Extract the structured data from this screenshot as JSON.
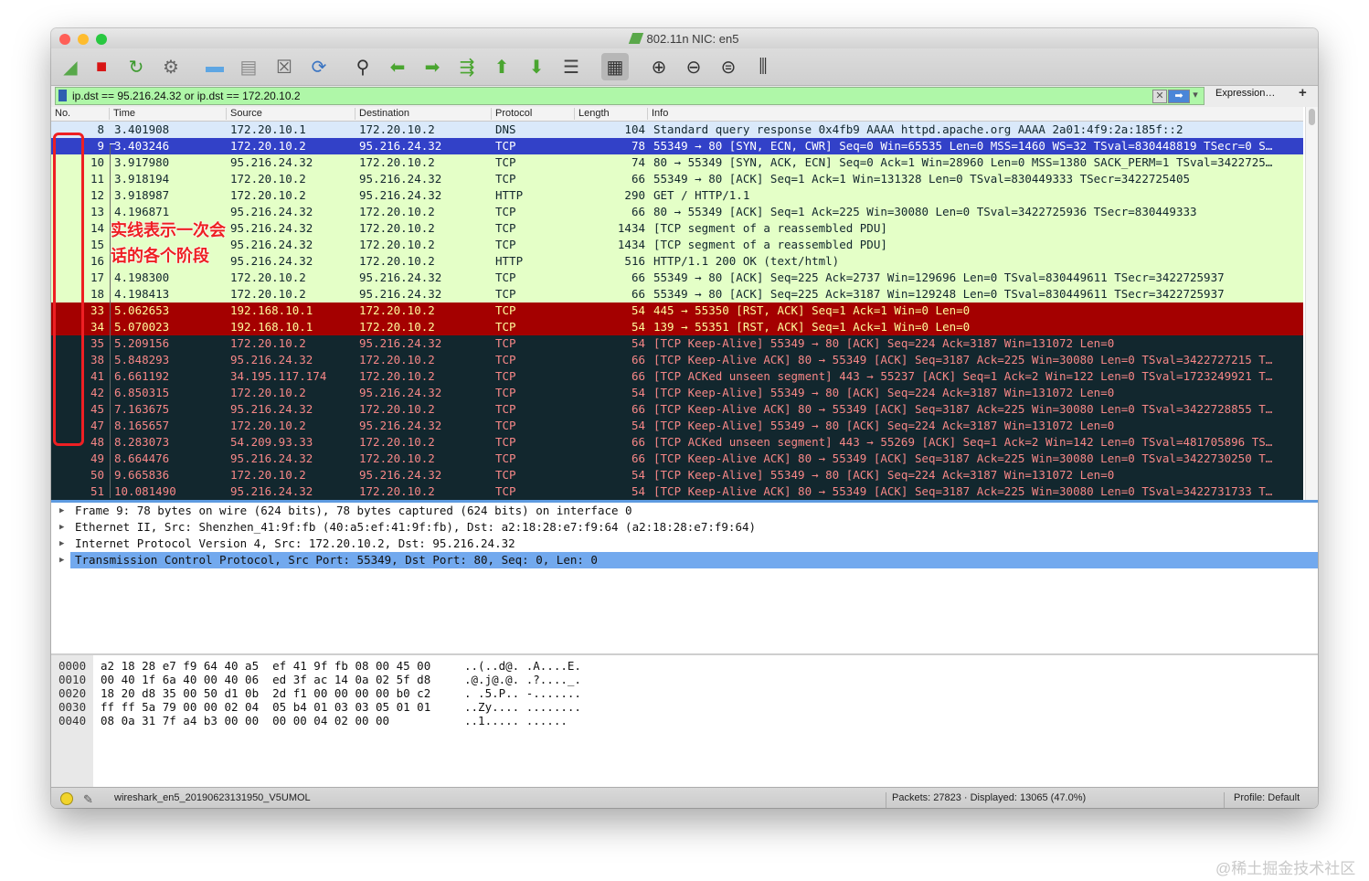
{
  "window": {
    "title": "802.11n NIC: en5",
    "traffic_lights": [
      "#ff5f57",
      "#febc2e",
      "#28c840"
    ]
  },
  "toolbar": {
    "buttons": [
      {
        "name": "start-capture-button",
        "icon": "shark-fin-icon",
        "glyph": "◢",
        "color": "#58a84a"
      },
      {
        "name": "stop-capture-button",
        "icon": "stop-icon",
        "glyph": "■",
        "color": "#d81414"
      },
      {
        "name": "restart-capture-button",
        "icon": "restart-icon",
        "glyph": "↻",
        "color": "#3d9a2f"
      },
      {
        "name": "capture-options-button",
        "icon": "gear-icon",
        "glyph": "⚙",
        "color": "#666666"
      },
      {
        "name": "open-file-button",
        "icon": "folder-icon",
        "glyph": "▬",
        "color": "#5ea6e3"
      },
      {
        "name": "save-file-button",
        "icon": "file-icon",
        "glyph": "▤",
        "color": "#8a8a8a"
      },
      {
        "name": "close-file-button",
        "icon": "close-file-icon",
        "glyph": "☒",
        "color": "#666666"
      },
      {
        "name": "reload-file-button",
        "icon": "reload-icon",
        "glyph": "⟳",
        "color": "#3a74c2"
      },
      {
        "name": "find-packet-button",
        "icon": "search-icon",
        "glyph": "⚲",
        "color": "#333333"
      },
      {
        "name": "go-back-button",
        "icon": "arrow-left-icon",
        "glyph": "⬅",
        "color": "#4aa530"
      },
      {
        "name": "go-forward-button",
        "icon": "arrow-right-icon",
        "glyph": "➡",
        "color": "#4aa530"
      },
      {
        "name": "go-to-packet-button",
        "icon": "go-to-packet-icon",
        "glyph": "⇶",
        "color": "#4aa530"
      },
      {
        "name": "first-packet-button",
        "icon": "arrow-up-icon",
        "glyph": "⬆",
        "color": "#4aa530"
      },
      {
        "name": "last-packet-button",
        "icon": "arrow-down-icon",
        "glyph": "⬇",
        "color": "#4aa530"
      },
      {
        "name": "auto-scroll-button",
        "icon": "auto-scroll-icon",
        "glyph": "☰",
        "color": "#444444"
      },
      {
        "name": "colorize-button",
        "icon": "colorize-icon",
        "glyph": "▦",
        "color": "#333333"
      },
      {
        "name": "zoom-in-button",
        "icon": "zoom-in-icon",
        "glyph": "⊕",
        "color": "#333333"
      },
      {
        "name": "zoom-out-button",
        "icon": "zoom-out-icon",
        "glyph": "⊖",
        "color": "#333333"
      },
      {
        "name": "normal-size-button",
        "icon": "zoom-reset-icon",
        "glyph": "⊜",
        "color": "#333333"
      },
      {
        "name": "resize-columns-button",
        "icon": "resize-columns-icon",
        "glyph": "⫼",
        "color": "#333333"
      }
    ]
  },
  "filter": {
    "value": "ip.dst == 95.216.24.32 or ip.dst == 172.20.10.2",
    "expression_label": "Expression…",
    "add_label": "+",
    "clear_glyph": "✕",
    "apply_glyph": "➡",
    "dropdown_glyph": "▾"
  },
  "columns": {
    "no": "No.",
    "time": "Time",
    "source": "Source",
    "destination": "Destination",
    "protocol": "Protocol",
    "length": "Length",
    "info": "Info"
  },
  "row_styles": {
    "dns": {
      "bg": "#dae9fa",
      "fg": "#12272e"
    },
    "selected": {
      "bg": "#3241c8",
      "fg": "#ffffff"
    },
    "tcp": {
      "bg": "#e4ffc7",
      "fg": "#12272e"
    },
    "http": {
      "bg": "#e4ffc7",
      "fg": "#12272e"
    },
    "rst": {
      "bg": "#a40000",
      "fg": "#fffc9c"
    },
    "bad": {
      "bg": "#12272e",
      "fg": "#f78787"
    }
  },
  "packets": [
    {
      "no": "8",
      "time": "3.401908",
      "src": "172.20.10.1",
      "dst": "172.20.10.2",
      "proto": "DNS",
      "len": "104",
      "info": "Standard query response 0x4fb9 AAAA httpd.apache.org AAAA 2a01:4f9:2a:185f::2",
      "style": "dns"
    },
    {
      "no": "9",
      "time": "3.403246",
      "src": "172.20.10.2",
      "dst": "95.216.24.32",
      "proto": "TCP",
      "len": "78",
      "info": "55349 → 80 [SYN, ECN, CWR] Seq=0 Win=65535 Len=0 MSS=1460 WS=32 TSval=830448819 TSecr=0 S…",
      "style": "selected"
    },
    {
      "no": "10",
      "time": "3.917980",
      "src": "95.216.24.32",
      "dst": "172.20.10.2",
      "proto": "TCP",
      "len": "74",
      "info": "80 → 55349 [SYN, ACK, ECN] Seq=0 Ack=1 Win=28960 Len=0 MSS=1380 SACK_PERM=1 TSval=3422725…",
      "style": "tcp"
    },
    {
      "no": "11",
      "time": "3.918194",
      "src": "172.20.10.2",
      "dst": "95.216.24.32",
      "proto": "TCP",
      "len": "66",
      "info": "55349 → 80 [ACK] Seq=1 Ack=1 Win=131328 Len=0 TSval=830449333 TSecr=3422725405",
      "style": "tcp"
    },
    {
      "no": "12",
      "time": "3.918987",
      "src": "172.20.10.2",
      "dst": "95.216.24.32",
      "proto": "HTTP",
      "len": "290",
      "info": "GET / HTTP/1.1",
      "style": "http"
    },
    {
      "no": "13",
      "time": "4.196871",
      "src": "95.216.24.32",
      "dst": "172.20.10.2",
      "proto": "TCP",
      "len": "66",
      "info": "80 → 55349 [ACK] Seq=1 Ack=225 Win=30080 Len=0 TSval=3422725936 TSecr=830449333",
      "style": "tcp"
    },
    {
      "no": "14",
      "time": "",
      "src": "95.216.24.32",
      "dst": "172.20.10.2",
      "proto": "TCP",
      "len": "1434",
      "info": "[TCP segment of a reassembled PDU]",
      "style": "tcp"
    },
    {
      "no": "15",
      "time": "",
      "src": "95.216.24.32",
      "dst": "172.20.10.2",
      "proto": "TCP",
      "len": "1434",
      "info": "[TCP segment of a reassembled PDU]",
      "style": "tcp"
    },
    {
      "no": "16",
      "time": "",
      "src": "95.216.24.32",
      "dst": "172.20.10.2",
      "proto": "HTTP",
      "len": "516",
      "info": "HTTP/1.1 200 OK  (text/html)",
      "style": "http"
    },
    {
      "no": "17",
      "time": "4.198300",
      "src": "172.20.10.2",
      "dst": "95.216.24.32",
      "proto": "TCP",
      "len": "66",
      "info": "55349 → 80 [ACK] Seq=225 Ack=2737 Win=129696 Len=0 TSval=830449611 TSecr=3422725937",
      "style": "tcp"
    },
    {
      "no": "18",
      "time": "4.198413",
      "src": "172.20.10.2",
      "dst": "95.216.24.32",
      "proto": "TCP",
      "len": "66",
      "info": "55349 → 80 [ACK] Seq=225 Ack=3187 Win=129248 Len=0 TSval=830449611 TSecr=3422725937",
      "style": "tcp"
    },
    {
      "no": "33",
      "time": "5.062653",
      "src": "192.168.10.1",
      "dst": "172.20.10.2",
      "proto": "TCP",
      "len": "54",
      "info": "445 → 55350 [RST, ACK] Seq=1 Ack=1 Win=0 Len=0",
      "style": "rst"
    },
    {
      "no": "34",
      "time": "5.070023",
      "src": "192.168.10.1",
      "dst": "172.20.10.2",
      "proto": "TCP",
      "len": "54",
      "info": "139 → 55351 [RST, ACK] Seq=1 Ack=1 Win=0 Len=0",
      "style": "rst"
    },
    {
      "no": "35",
      "time": "5.209156",
      "src": "172.20.10.2",
      "dst": "95.216.24.32",
      "proto": "TCP",
      "len": "54",
      "info": "[TCP Keep-Alive] 55349 → 80 [ACK] Seq=224 Ack=3187 Win=131072 Len=0",
      "style": "bad"
    },
    {
      "no": "38",
      "time": "5.848293",
      "src": "95.216.24.32",
      "dst": "172.20.10.2",
      "proto": "TCP",
      "len": "66",
      "info": "[TCP Keep-Alive ACK] 80 → 55349 [ACK] Seq=3187 Ack=225 Win=30080 Len=0 TSval=3422727215 T…",
      "style": "bad"
    },
    {
      "no": "41",
      "time": "6.661192",
      "src": "34.195.117.174",
      "dst": "172.20.10.2",
      "proto": "TCP",
      "len": "66",
      "info": "[TCP ACKed unseen segment] 443 → 55237 [ACK] Seq=1 Ack=2 Win=122 Len=0 TSval=1723249921 T…",
      "style": "bad"
    },
    {
      "no": "42",
      "time": "6.850315",
      "src": "172.20.10.2",
      "dst": "95.216.24.32",
      "proto": "TCP",
      "len": "54",
      "info": "[TCP Keep-Alive] 55349 → 80 [ACK] Seq=224 Ack=3187 Win=131072 Len=0",
      "style": "bad"
    },
    {
      "no": "45",
      "time": "7.163675",
      "src": "95.216.24.32",
      "dst": "172.20.10.2",
      "proto": "TCP",
      "len": "66",
      "info": "[TCP Keep-Alive ACK] 80 → 55349 [ACK] Seq=3187 Ack=225 Win=30080 Len=0 TSval=3422728855 T…",
      "style": "bad"
    },
    {
      "no": "47",
      "time": "8.165657",
      "src": "172.20.10.2",
      "dst": "95.216.24.32",
      "proto": "TCP",
      "len": "54",
      "info": "[TCP Keep-Alive] 55349 → 80 [ACK] Seq=224 Ack=3187 Win=131072 Len=0",
      "style": "bad"
    },
    {
      "no": "48",
      "time": "8.283073",
      "src": "54.209.93.33",
      "dst": "172.20.10.2",
      "proto": "TCP",
      "len": "66",
      "info": "[TCP ACKed unseen segment] 443 → 55269 [ACK] Seq=1 Ack=2 Win=142 Len=0 TSval=481705896 TS…",
      "style": "bad"
    },
    {
      "no": "49",
      "time": "8.664476",
      "src": "95.216.24.32",
      "dst": "172.20.10.2",
      "proto": "TCP",
      "len": "66",
      "info": "[TCP Keep-Alive ACK] 80 → 55349 [ACK] Seq=3187 Ack=225 Win=30080 Len=0 TSval=3422730250 T…",
      "style": "bad"
    },
    {
      "no": "50",
      "time": "9.665836",
      "src": "172.20.10.2",
      "dst": "95.216.24.32",
      "proto": "TCP",
      "len": "54",
      "info": "[TCP Keep-Alive] 55349 → 80 [ACK] Seq=224 Ack=3187 Win=131072 Len=0",
      "style": "bad"
    },
    {
      "no": "51",
      "time": "10.081490",
      "src": "95.216.24.32",
      "dst": "172.20.10.2",
      "proto": "TCP",
      "len": "54",
      "info": "[TCP Keep-Alive ACK] 80 → 55349 [ACK] Seq=3187 Ack=225 Win=30080 Len=0 TSval=3422731733 T…",
      "style": "bad"
    }
  ],
  "details": [
    {
      "text": "Frame 9: 78 bytes on wire (624 bits), 78 bytes captured (624 bits) on interface 0",
      "selected": false
    },
    {
      "text": "Ethernet II, Src: Shenzhen_41:9f:fb (40:a5:ef:41:9f:fb), Dst: a2:18:28:e7:f9:64 (a2:18:28:e7:f9:64)",
      "selected": false
    },
    {
      "text": "Internet Protocol Version 4, Src: 172.20.10.2, Dst: 95.216.24.32",
      "selected": false
    },
    {
      "text": "Transmission Control Protocol, Src Port: 55349, Dst Port: 80, Seq: 0, Len: 0",
      "selected": true
    }
  ],
  "bytes": [
    {
      "offset": "0000",
      "hex": "a2 18 28 e7 f9 64 40 a5  ef 41 9f fb 08 00 45 00",
      "ascii": "..(..d@. .A....E."
    },
    {
      "offset": "0010",
      "hex": "00 40 1f 6a 40 00 40 06  ed 3f ac 14 0a 02 5f d8",
      "ascii": ".@.j@.@. .?...._."
    },
    {
      "offset": "0020",
      "hex": "18 20 d8 35 00 50 d1 0b  2d f1 00 00 00 00 b0 c2",
      "ascii": ". .5.P.. -......."
    },
    {
      "offset": "0030",
      "hex": "ff ff 5a 79 00 00 02 04  05 b4 01 03 03 05 01 01",
      "ascii": "..Zy.... ........"
    },
    {
      "offset": "0040",
      "hex": "08 0a 31 7f a4 b3 00 00  00 00 04 02 00 00",
      "ascii": "..1..... ......"
    }
  ],
  "status": {
    "file": "wireshark_en5_20190623131950_V5UMOL",
    "packets": "Packets: 27823 · Displayed: 13065 (47.0%)",
    "profile": "Profile: Default"
  },
  "annotation": {
    "line1": "实线表示一次会",
    "line2": "话的各个阶段",
    "color": "#ee1f23"
  },
  "watermark": "@稀土掘金技术社区"
}
